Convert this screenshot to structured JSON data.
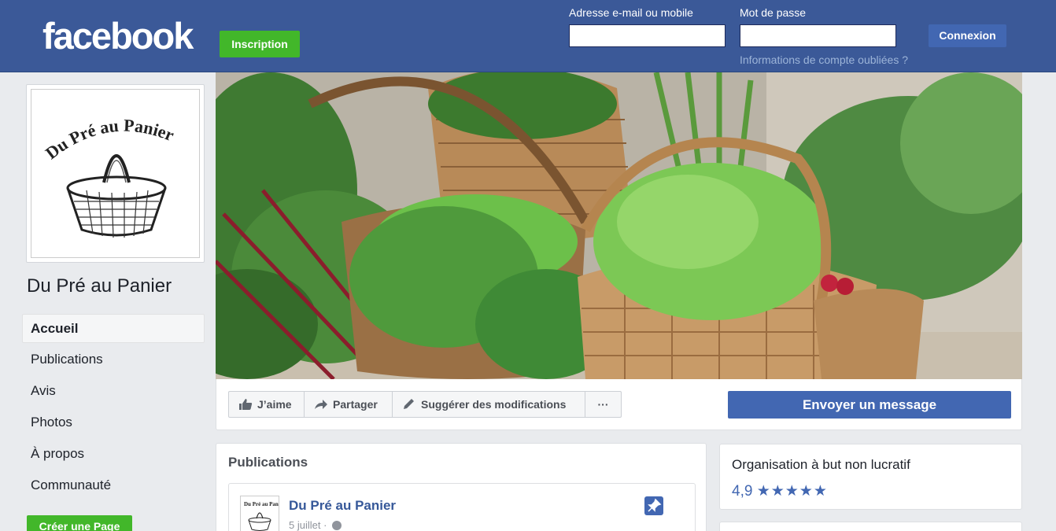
{
  "header": {
    "logo_text": "facebook",
    "signup_label": "Inscription",
    "email_label": "Adresse e-mail ou mobile",
    "email_value": "",
    "password_label": "Mot de passe",
    "password_value": "",
    "login_label": "Connexion",
    "forgot_label": "Informations de compte oubliées ?"
  },
  "sidebar": {
    "logo_text": "Du Pré au Panier",
    "page_name": "Du Pré au Panier",
    "items": [
      {
        "label": "Accueil"
      },
      {
        "label": "Publications"
      },
      {
        "label": "Avis"
      },
      {
        "label": "Photos"
      },
      {
        "label": "À propos"
      },
      {
        "label": "Communauté"
      }
    ],
    "create_page_label": "Créer une Page"
  },
  "actions": {
    "like_label": "J’aime",
    "share_label": "Partager",
    "suggest_label": "Suggérer des modifications",
    "more_label": "···",
    "message_label": "Envoyer un message"
  },
  "publications": {
    "title": "Publications",
    "post": {
      "author": "Du Pré au Panier",
      "date": "5 juillet ·",
      "avatar_text": "Du Pré au Panier"
    }
  },
  "info": {
    "category": "Organisation à but non lucratif",
    "rating": "4,9",
    "stars": "★★★★★"
  },
  "colors": {
    "brand_blue": "#3b5998",
    "button_blue": "#4267b2",
    "green": "#42b72a",
    "background": "#e9ebee"
  }
}
